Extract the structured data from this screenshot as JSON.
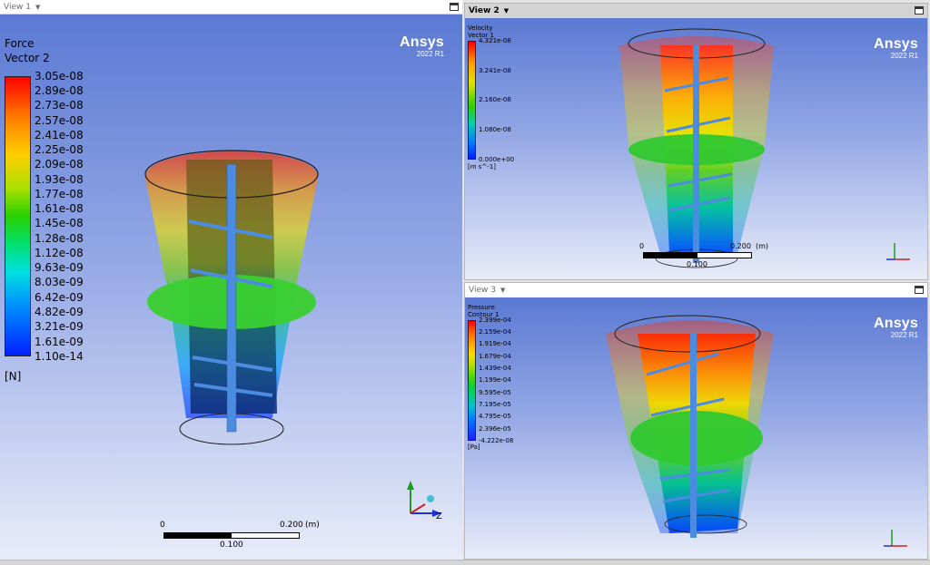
{
  "colors": {
    "bg_top": "#5b79d3",
    "bg_bottom": "#e8ecf9",
    "active_header": "#d4d4d4",
    "inactive_header": "#ffffff",
    "ansys_text": "#ffffff"
  },
  "view1": {
    "header": {
      "label": "View 1",
      "menu_icon": "triangle-down-icon",
      "maximize_icon": "maximize-icon"
    },
    "logo": {
      "name": "Ansys",
      "version": "2022 R1"
    },
    "legend": {
      "variable": "Force",
      "name": "Vector 2",
      "unit": "[N]",
      "ticks": [
        "3.05e-08",
        "2.89e-08",
        "2.73e-08",
        "2.57e-08",
        "2.41e-08",
        "2.25e-08",
        "2.09e-08",
        "1.93e-08",
        "1.77e-08",
        "1.61e-08",
        "1.45e-08",
        "1.28e-08",
        "1.12e-08",
        "9.63e-09",
        "8.03e-09",
        "6.42e-09",
        "4.82e-09",
        "3.21e-09",
        "1.61e-09",
        "1.10e-14"
      ]
    },
    "scale": {
      "start": "0",
      "end": "0.200",
      "unit": "(m)",
      "mid": "0.100"
    },
    "axes": {
      "icon": "xyz-axis-triad-icon",
      "z_label": "Z"
    }
  },
  "view2": {
    "header": {
      "label": "View 2",
      "menu_icon": "triangle-down-icon",
      "maximize_icon": "maximize-icon"
    },
    "logo": {
      "name": "Ansys",
      "version": "2022 R1"
    },
    "legend": {
      "variable": "Velocity",
      "name": "Vector 1",
      "unit": "[m s^-1]",
      "ticks": [
        "4.321e-08",
        "3.241e-08",
        "2.160e-08",
        "1.080e-08",
        "0.000e+00"
      ]
    },
    "scale": {
      "start": "0",
      "end": "0.200",
      "unit": "(m)",
      "mid": "0.100"
    },
    "axes": {
      "icon": "xyz-axis-triad-icon"
    }
  },
  "view3": {
    "header": {
      "label": "View 3",
      "menu_icon": "triangle-down-icon",
      "maximize_icon": "maximize-icon"
    },
    "logo": {
      "name": "Ansys",
      "version": "2022 R1"
    },
    "legend": {
      "variable": "Pressure",
      "name": "Contour 1",
      "unit": "[Pa]",
      "ticks": [
        "2.399e-04",
        "2.159e-04",
        "1.919e-04",
        "1.679e-04",
        "1.439e-04",
        "1.199e-04",
        "9.595e-05",
        "7.195e-05",
        "4.795e-05",
        "2.396e-05",
        "-4.222e-08"
      ]
    },
    "axes": {
      "icon": "xyz-axis-triad-icon"
    }
  }
}
